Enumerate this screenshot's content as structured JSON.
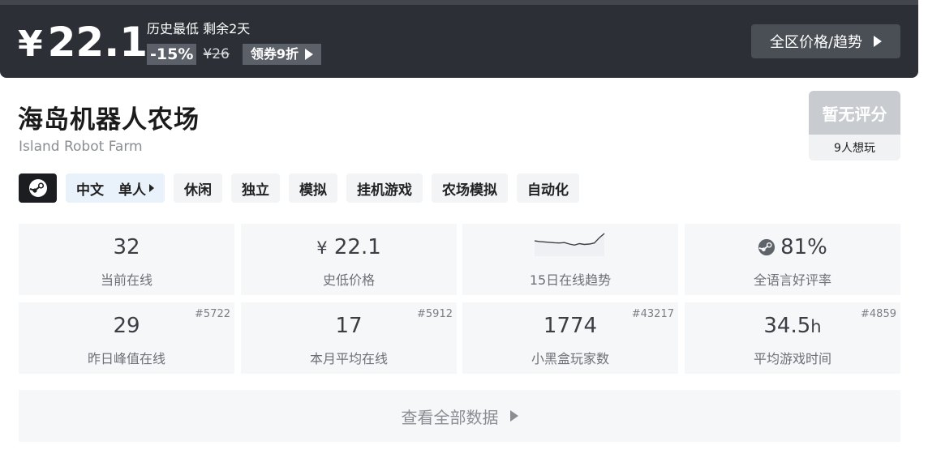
{
  "banner": {
    "currency": "¥",
    "price": "22.1",
    "low_info": "历史最低 剩余2天",
    "discount": "-15%",
    "original_price": "¥26",
    "coupon_label": "领券9折",
    "region_button": "全区价格/趋势"
  },
  "game": {
    "title": "海岛机器人农场",
    "english_title": "Island Robot Farm"
  },
  "rating": {
    "score": "暂无评分",
    "want": "9人想玩"
  },
  "tags": {
    "platform_icon": "steam-icon",
    "lang": "中文",
    "mode": "单人",
    "items": [
      "休闲",
      "独立",
      "模拟",
      "挂机游戏",
      "农场模拟",
      "自动化"
    ]
  },
  "stats": [
    {
      "value": "32",
      "label": "当前在线",
      "rank": ""
    },
    {
      "prefix": "¥",
      "value": "22.1",
      "label": "史低价格",
      "rank": ""
    },
    {
      "value": "",
      "label": "15日在线趋势",
      "rank": "",
      "trend": [
        0.35,
        0.38,
        0.4,
        0.42,
        0.44,
        0.45,
        0.43,
        0.5,
        0.55,
        0.48,
        0.52,
        0.5,
        0.45,
        0.2,
        0.0
      ]
    },
    {
      "value": "81%",
      "label": "全语言好评率",
      "rank": "",
      "icon": "steam-icon"
    },
    {
      "value": "29",
      "label": "昨日峰值在线",
      "rank": "#5722"
    },
    {
      "value": "17",
      "label": "本月平均在线",
      "rank": "#5912"
    },
    {
      "value": "1774",
      "label": "小黑盒玩家数",
      "rank": "#43217"
    },
    {
      "value": "34.5",
      "unit": "h",
      "label": "平均游戏时间",
      "rank": "#4859"
    }
  ],
  "all_data_button": "查看全部数据",
  "colors": {
    "banner_bg": "#2c3036",
    "tag_bg": "#f3f4f6",
    "lang_tag_bg": "#e9f1fb",
    "stat_bg": "#f6f7f9"
  }
}
